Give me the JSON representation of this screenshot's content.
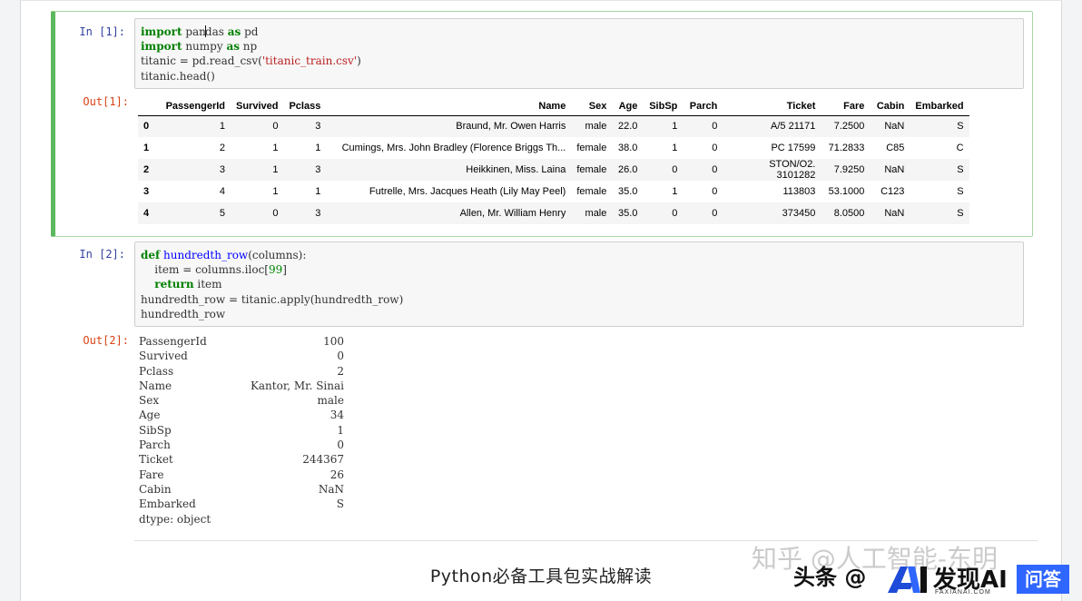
{
  "cells": [
    {
      "in_prompt": "In  [1]:",
      "code_lines": [
        [
          {
            "t": "import",
            "c": "kw"
          },
          {
            "t": " pan",
            "c": ""
          },
          {
            "t": "",
            "c": "cursor"
          },
          {
            "t": "das ",
            "c": ""
          },
          {
            "t": "as",
            "c": "kw"
          },
          {
            "t": " pd",
            "c": ""
          }
        ],
        [
          {
            "t": "import",
            "c": "kw"
          },
          {
            "t": " numpy ",
            "c": ""
          },
          {
            "t": "as",
            "c": "kw"
          },
          {
            "t": " np",
            "c": ""
          }
        ],
        [
          {
            "t": "titanic = pd.read_csv(",
            "c": ""
          },
          {
            "t": "'titanic_train.csv'",
            "c": "str"
          },
          {
            "t": ")",
            "c": ""
          }
        ],
        [
          {
            "t": "titanic.head()",
            "c": ""
          }
        ]
      ],
      "out_prompt": "Out[1]:",
      "table": {
        "columns": [
          "",
          "PassengerId",
          "Survived",
          "Pclass",
          "Name",
          "Sex",
          "Age",
          "SibSp",
          "Parch",
          "Ticket",
          "Fare",
          "Cabin",
          "Embarked"
        ],
        "rows": [
          [
            "0",
            "1",
            "0",
            "3",
            "Braund, Mr. Owen Harris",
            "male",
            "22.0",
            "1",
            "0",
            "A/5 21171",
            "7.2500",
            "NaN",
            "S"
          ],
          [
            "1",
            "2",
            "1",
            "1",
            "Cumings, Mrs. John Bradley (Florence Briggs Th...",
            "female",
            "38.0",
            "1",
            "0",
            "PC 17599",
            "71.2833",
            "C85",
            "C"
          ],
          [
            "2",
            "3",
            "1",
            "3",
            "Heikkinen, Miss. Laina",
            "female",
            "26.0",
            "0",
            "0",
            "STON/O2. 3101282",
            "7.9250",
            "NaN",
            "S"
          ],
          [
            "3",
            "4",
            "1",
            "1",
            "Futrelle, Mrs. Jacques Heath (Lily May Peel)",
            "female",
            "35.0",
            "1",
            "0",
            "113803",
            "53.1000",
            "C123",
            "S"
          ],
          [
            "4",
            "5",
            "0",
            "3",
            "Allen, Mr. William Henry",
            "male",
            "35.0",
            "0",
            "0",
            "373450",
            "8.0500",
            "NaN",
            "S"
          ]
        ]
      }
    },
    {
      "in_prompt": "In  [2]:",
      "code_lines": [
        [
          {
            "t": "def",
            "c": "kw"
          },
          {
            "t": " ",
            "c": ""
          },
          {
            "t": "hundredth_row",
            "c": "fn"
          },
          {
            "t": "(columns):",
            "c": ""
          }
        ],
        [
          {
            "t": "    item = columns.iloc[",
            "c": ""
          },
          {
            "t": "99",
            "c": "num"
          },
          {
            "t": "]",
            "c": ""
          }
        ],
        [
          {
            "t": "    ",
            "c": ""
          },
          {
            "t": "return",
            "c": "kw"
          },
          {
            "t": " item",
            "c": ""
          }
        ],
        [
          {
            "t": "hundredth_row = titanic.apply(hundredth_row)",
            "c": ""
          }
        ],
        [
          {
            "t": "hundredth_row",
            "c": ""
          }
        ]
      ],
      "out_prompt": "Out[2]:",
      "series": [
        [
          "PassengerId",
          "100"
        ],
        [
          "Survived",
          "0"
        ],
        [
          "Pclass",
          "2"
        ],
        [
          "Name",
          "Kantor, Mr. Sinai"
        ],
        [
          "Sex",
          "male"
        ],
        [
          "Age",
          "34"
        ],
        [
          "SibSp",
          "1"
        ],
        [
          "Parch",
          "0"
        ],
        [
          "Ticket",
          "244367"
        ],
        [
          "Fare",
          "26"
        ],
        [
          "Cabin",
          "NaN"
        ],
        [
          "Embarked",
          "S"
        ]
      ],
      "dtype_line": "dtype: object"
    }
  ],
  "caption": "Python必备工具包实战解读",
  "watermarks": {
    "zhihu": "知乎 @人工智能-东明",
    "toutiao": "头条 @",
    "brand_cn": "发现AI",
    "brand_en": "FAXIANAI.COM",
    "brand_badge": "问答"
  },
  "colors": {
    "selected_cell_border": "#5cb85c",
    "in_prompt": "#303f9f",
    "out_prompt": "#d84315",
    "keyword": "#008000",
    "string": "#ba2121",
    "brand_badge": "#2f66ff"
  }
}
